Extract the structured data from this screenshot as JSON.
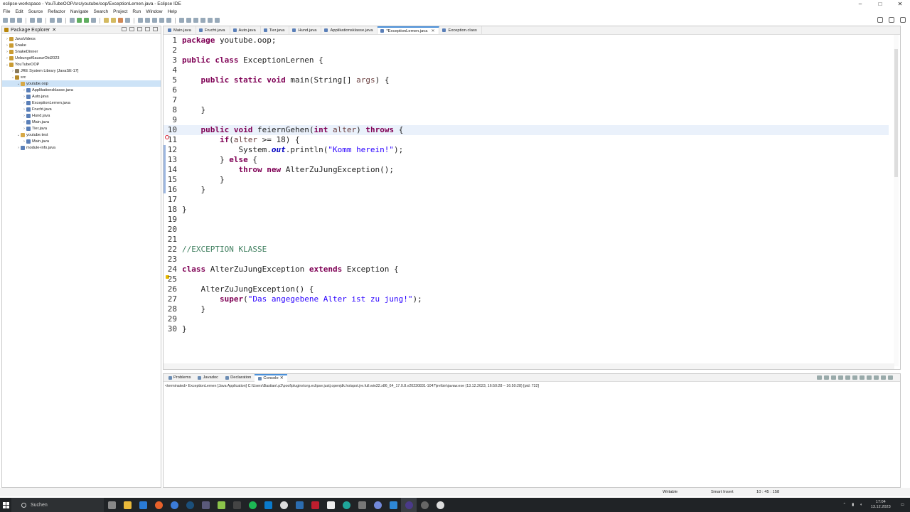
{
  "window": {
    "title": "eclipse-workspace - YouTubeOOP/src/youtube/oop/ExceptionLernen.java - Eclipse IDE",
    "min": "–",
    "max": "□",
    "close": "✕"
  },
  "menu": [
    "File",
    "Edit",
    "Source",
    "Refactor",
    "Navigate",
    "Search",
    "Project",
    "Run",
    "Window",
    "Help"
  ],
  "package_explorer": {
    "title": "Package Explorer",
    "close": "✕",
    "items": [
      {
        "arrow": "›",
        "icon": "proj",
        "label": "JavaVideos"
      },
      {
        "arrow": "›",
        "icon": "proj",
        "label": "Snake"
      },
      {
        "arrow": "›",
        "icon": "proj",
        "label": "SnakeDinner"
      },
      {
        "arrow": "›",
        "icon": "proj",
        "label": "UebungsKlausurOkt2023"
      },
      {
        "arrow": "⌄",
        "icon": "proj",
        "label": "YouTubeOOP"
      },
      {
        "arrow": "›",
        "icon": "lib",
        "label": "JRE System Library [JavaSE-17]"
      },
      {
        "arrow": "⌄",
        "icon": "src",
        "label": "src"
      },
      {
        "arrow": "⌄",
        "icon": "pkg",
        "label": "youtube.oop"
      },
      {
        "arrow": "›",
        "icon": "jf",
        "label": "Applikationsklasse.java"
      },
      {
        "arrow": "›",
        "icon": "jf",
        "label": "Auto.java"
      },
      {
        "arrow": "›",
        "icon": "jf",
        "label": "ExceptionLernen.java"
      },
      {
        "arrow": "›",
        "icon": "jf",
        "label": "Frucht.java"
      },
      {
        "arrow": "›",
        "icon": "jf",
        "label": "Hund.java"
      },
      {
        "arrow": "›",
        "icon": "jf",
        "label": "Main.java"
      },
      {
        "arrow": "›",
        "icon": "jf",
        "label": "Tier.java"
      },
      {
        "arrow": "⌄",
        "icon": "pkg",
        "label": "youtube.test"
      },
      {
        "arrow": "›",
        "icon": "jf",
        "label": "Main.java"
      },
      {
        "arrow": "›",
        "icon": "jf",
        "label": "module-info.java"
      }
    ]
  },
  "editor_tabs": [
    {
      "label": "Main.java"
    },
    {
      "label": "Frucht.java"
    },
    {
      "label": "Auto.java"
    },
    {
      "label": "Tier.java"
    },
    {
      "label": "Hund.java"
    },
    {
      "label": "Applikationsklasse.java"
    },
    {
      "label": "*ExceptionLernen.java",
      "active": true
    },
    {
      "label": "Exception.class"
    }
  ],
  "code": {
    "lines": [
      "1",
      "2",
      "3",
      "4",
      "5",
      "6",
      "7",
      "8",
      "9",
      "10",
      "11",
      "12",
      "13",
      "14",
      "15",
      "16",
      "17",
      "18",
      "19",
      "20",
      "21",
      "22",
      "23",
      "24",
      "25",
      "26",
      "27",
      "28",
      "29",
      "30"
    ],
    "l1a": "package",
    "l1b": " youtube.oop;",
    "l3a": "public",
    "l3b": " ",
    "l3c": "class",
    "l3d": " ExceptionLernen {",
    "l5a": "    ",
    "l5b": "public",
    "l5c": " ",
    "l5d": "static",
    "l5e": " ",
    "l5f": "void",
    "l5g": " main(String[] ",
    "l5h": "args",
    "l5i": ") {",
    "l8": "    }",
    "l10a": "    ",
    "l10b": "public",
    "l10c": " ",
    "l10d": "void",
    "l10e": " feiernGehen(",
    "l10f": "int",
    "l10g": " ",
    "l10h": "alter",
    "l10i": ") ",
    "l10j": "throws",
    "l10k": " {",
    "l11a": "        ",
    "l11b": "if",
    "l11c": "(",
    "l11d": "alter",
    "l11e": " >= 18) {",
    "l12a": "            System.",
    "l12b": "out",
    "l12c": ".println(",
    "l12d": "\"Komm herein!\"",
    "l12e": ");",
    "l13a": "        } ",
    "l13b": "else",
    "l13c": " {",
    "l14a": "            ",
    "l14b": "throw",
    "l14c": " ",
    "l14d": "new",
    "l14e": " AlterZuJungException();",
    "l15": "        }",
    "l16": "    }",
    "l18": "}",
    "l22": "//EXCEPTION KLASSE",
    "l24a": "class",
    "l24b": " AlterZuJungException ",
    "l24c": "extends",
    "l24d": " Exception {",
    "l26": "    AlterZuJungException() {",
    "l27a": "        ",
    "l27b": "super",
    "l27c": "(",
    "l27d": "\"Das angegebene Alter ist zu jung!\"",
    "l27e": ");",
    "l28": "    }",
    "l30": "}"
  },
  "console": {
    "tabs": [
      "Problems",
      "Javadoc",
      "Declaration",
      "Console"
    ],
    "line": "<terminated> ExceptionLernen [Java Application] C:\\Users\\Bastian\\.p2\\pool\\plugins\\org.eclipse.justj.openjdk.hotspot.jre.full.win32.x86_64_17.0.8.v20230831-1047\\jre\\bin\\javaw.exe  (13.12.2023, 16:50:28 – 16:50:28) [pid: 732]"
  },
  "status": {
    "writable": "Writable",
    "insert": "Smart Insert",
    "pos": "10 : 45 : 158"
  },
  "taskbar": {
    "search": "Suchen",
    "time": "17:04",
    "date": "13.12.2023"
  },
  "colors": {
    "keyword": "#7f0055",
    "string": "#2a00ff",
    "comment": "#3f7f5f",
    "accent": "#4a90d9",
    "taskbar": "#202326"
  }
}
